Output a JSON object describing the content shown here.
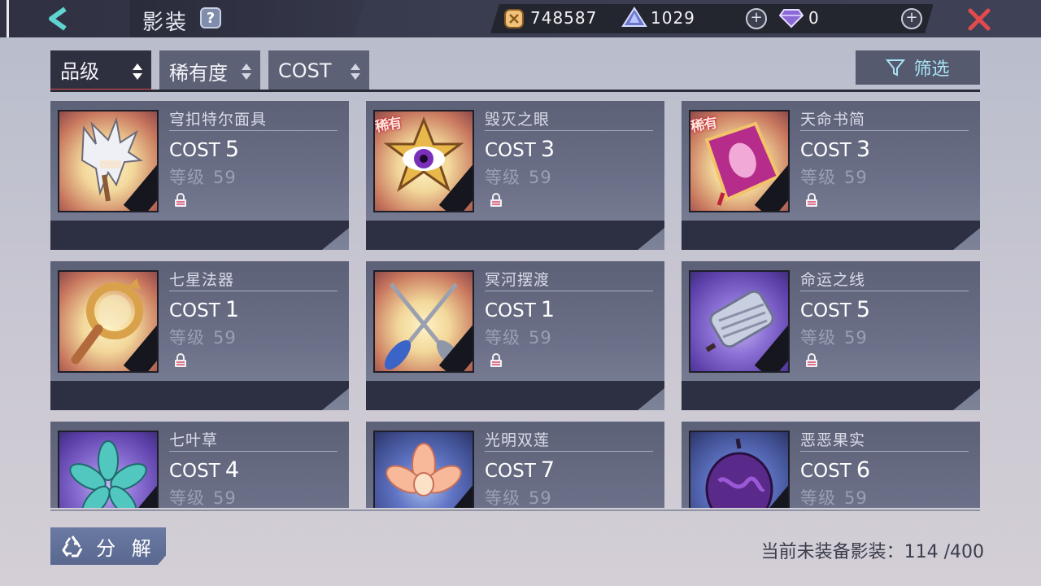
{
  "header": {
    "title": "影装",
    "help_label": "?",
    "currency_gold": "748587",
    "currency_crystal": "1029",
    "currency_gem": "0",
    "plus_label": "+"
  },
  "tabs": [
    {
      "label": "品级",
      "active": true
    },
    {
      "label": "稀有度",
      "active": false
    },
    {
      "label": "COST",
      "active": false
    }
  ],
  "filter_label": "筛选",
  "cost_prefix": "COST",
  "level_prefix": "等级",
  "rare_tag": "稀有",
  "items": [
    {
      "name": "穹扣特尔面具",
      "cost": "5",
      "level": "59",
      "rare": false,
      "theme": "warm"
    },
    {
      "name": "毁灭之眼",
      "cost": "3",
      "level": "59",
      "rare": true,
      "theme": "warm"
    },
    {
      "name": "天命书简",
      "cost": "3",
      "level": "59",
      "rare": true,
      "theme": "warm"
    },
    {
      "name": "七星法器",
      "cost": "1",
      "level": "59",
      "rare": false,
      "theme": "warm"
    },
    {
      "name": "冥河摆渡",
      "cost": "1",
      "level": "59",
      "rare": false,
      "theme": "warm"
    },
    {
      "name": "命运之线",
      "cost": "5",
      "level": "59",
      "rare": false,
      "theme": "purple"
    },
    {
      "name": "七叶草",
      "cost": "4",
      "level": "59",
      "rare": false,
      "theme": "purple"
    },
    {
      "name": "光明双莲",
      "cost": "7",
      "level": "59",
      "rare": false,
      "theme": "blue"
    },
    {
      "name": "恶恶果实",
      "cost": "6",
      "level": "59",
      "rare": false,
      "theme": "blue"
    }
  ],
  "footer": {
    "decompose_label": "分 解",
    "equip_count_label": "当前未装备影装：114 /400"
  },
  "colors": {
    "tab_active_underline": "#e4494e",
    "close_icon": "#e4494e",
    "back_icon": "#5fd4d0"
  }
}
